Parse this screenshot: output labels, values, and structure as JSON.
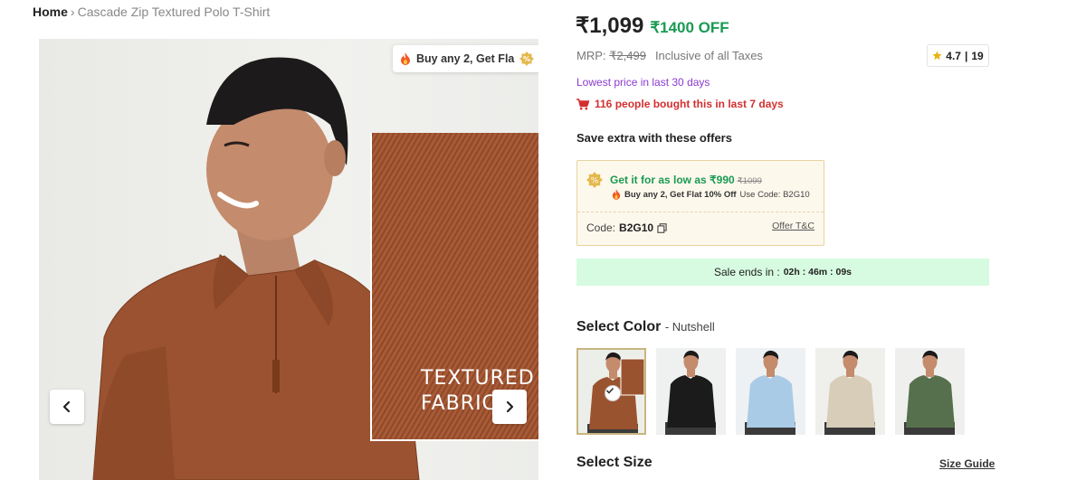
{
  "breadcrumb": {
    "home": "Home",
    "separator": "›",
    "current": "Cascade Zip Textured Polo T-Shirt"
  },
  "gallery": {
    "offer_chip": "Buy any 2, Get Fla",
    "fabric_line1": "TEXTURED",
    "fabric_line2": "FABRIC",
    "prev_icon": "chevron-left-icon",
    "next_icon": "chevron-right-icon"
  },
  "price": {
    "current": "₹1,099",
    "off": "₹1400 OFF",
    "mrp_label": "MRP:",
    "mrp_value": "₹2,499",
    "tax_note": "Inclusive of all Taxes"
  },
  "rating": {
    "value": "4.7",
    "separator": "|",
    "count": "19"
  },
  "badges": {
    "lowest": "Lowest price in last 30 days",
    "bought": "116 people bought this in last 7 days"
  },
  "offers": {
    "title": "Save extra with these offers",
    "headline": "Get it for as low as ₹990",
    "strike": "₹1099",
    "detail_bold": "Buy any 2, Get Flat 10% Off",
    "detail_rest": "Use Code: B2G10",
    "code_label": "Code:",
    "code_value": "B2G10",
    "tnc": "Offer T&C"
  },
  "sale": {
    "label": "Sale ends in :",
    "time": "02h : 46m : 09s"
  },
  "color": {
    "title": "Select Color",
    "selected": "- Nutshell",
    "swatches": [
      {
        "name": "Nutshell",
        "shirt": "#9a532f",
        "bg": "#eceee9"
      },
      {
        "name": "Black",
        "shirt": "#1b1b1b",
        "bg": "#eff0f0"
      },
      {
        "name": "Light Blue",
        "shirt": "#aacbe6",
        "bg": "#eef1f3"
      },
      {
        "name": "Beige",
        "shirt": "#d8cdb9",
        "bg": "#efefec"
      },
      {
        "name": "Olive",
        "shirt": "#56704d",
        "bg": "#eff0ee"
      }
    ]
  },
  "size": {
    "title": "Select Size",
    "guide": "Size Guide"
  },
  "colors": {
    "green": "#1a9a53",
    "purple": "#8a3bd1",
    "red": "#d42f2f",
    "sale_bg": "#d6fbe0"
  }
}
